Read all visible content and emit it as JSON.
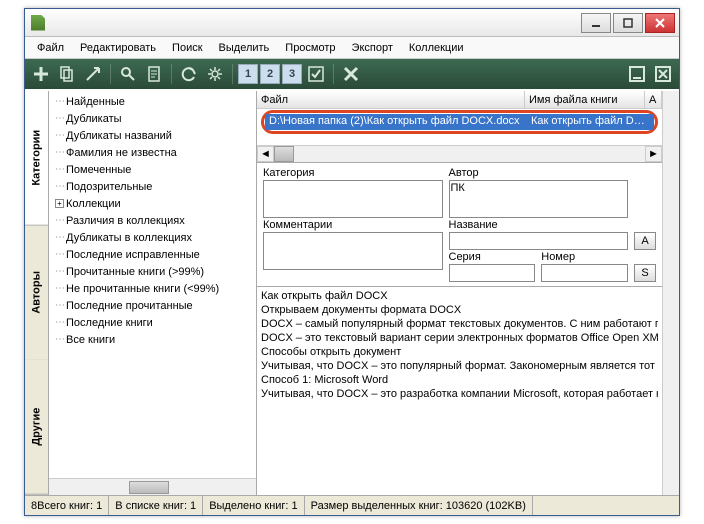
{
  "menu": [
    "Файл",
    "Редактировать",
    "Поиск",
    "Выделить",
    "Просмотр",
    "Экспорт",
    "Коллекции"
  ],
  "vtabs": [
    "Категории",
    "Авторы",
    "Другие"
  ],
  "tree": [
    {
      "label": "Найденные",
      "exp": null
    },
    {
      "label": "Дубликаты",
      "exp": null
    },
    {
      "label": "Дубликаты названий",
      "exp": null
    },
    {
      "label": "Фамилия не известна",
      "exp": null
    },
    {
      "label": "Помеченные",
      "exp": null
    },
    {
      "label": "Подозрительные",
      "exp": null
    },
    {
      "label": "Коллекции",
      "exp": "+"
    },
    {
      "label": "Различия в коллекциях",
      "exp": null
    },
    {
      "label": "Дубликаты в коллекциях",
      "exp": null
    },
    {
      "label": "Последние исправленные",
      "exp": null
    },
    {
      "label": "Прочитанные книги (>99%)",
      "exp": null
    },
    {
      "label": "Не прочитанные книги (<99%)",
      "exp": null
    },
    {
      "label": "Последние прочитанные",
      "exp": null
    },
    {
      "label": "Последние книги",
      "exp": null
    },
    {
      "label": "Все книги",
      "exp": null
    }
  ],
  "columns": {
    "file": "Файл",
    "bookname": "Имя файла книги",
    "a": "А"
  },
  "row": {
    "file": "D:\\Новая папка (2)\\Как открыть файл DOCX.docx",
    "bookname": "Как открыть файл DO..."
  },
  "form": {
    "category": "Категория",
    "author": "Автор",
    "author_val": "ПК",
    "comments": "Комментарии",
    "title": "Название",
    "series": "Серия",
    "number": "Номер",
    "btn_a": "A",
    "btn_s": "S"
  },
  "preview": [
    "Как открыть файл DOCX",
    "Открываем документы формата DOCX",
    "DOCX – самый популярный формат текстовых документов. С ним работают поч",
    "DOCX – это текстовый вариант серии электронных форматов Office Open XML.",
    "Способы открыть документ",
    "Учитывая, что DOCX – это популярный формат. Закономерным является тот фак",
    "Способ 1: Microsoft Word",
    "Учитывая, что DOCX – это разработка компании Microsoft, которая работает на"
  ],
  "status": {
    "total": "8Всего книг: 1",
    "inlist": "В списке книг: 1",
    "selected": "Выделено книг: 1",
    "size": "Размер выделенных книг: 103620  (102KB)"
  },
  "toolbar_nums": [
    "1",
    "2",
    "3"
  ]
}
